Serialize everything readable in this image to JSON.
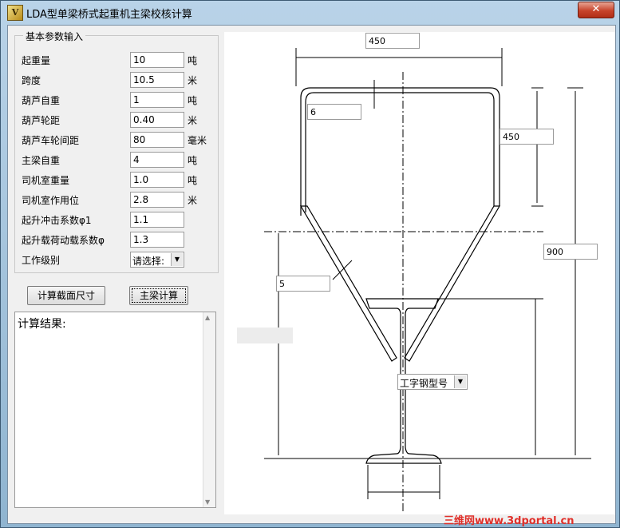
{
  "window": {
    "title": "LDA型单梁桥式起重机主梁校核计算",
    "close_glyph": "✕",
    "app_icon_glyph": "V"
  },
  "params": {
    "legend": "基本参数输入",
    "rows": [
      {
        "label": "起重量",
        "value": "10",
        "unit": "吨"
      },
      {
        "label": "跨度",
        "value": "10.5",
        "unit": "米"
      },
      {
        "label": "葫芦自重",
        "value": "1",
        "unit": "吨"
      },
      {
        "label": "葫芦轮距",
        "value": "0.40",
        "unit": "米"
      },
      {
        "label": "葫芦车轮间距",
        "value": "80",
        "unit": "毫米"
      },
      {
        "label": "主梁自重",
        "value": "4",
        "unit": "吨"
      },
      {
        "label": "司机室重量",
        "value": "1.0",
        "unit": "吨"
      },
      {
        "label": "司机室作用位",
        "value": "2.8",
        "unit": "米"
      },
      {
        "label": "起升冲击系数φ1",
        "value": "1.1",
        "unit": ""
      },
      {
        "label": "起升载荷动载系数φ",
        "value": "1.3",
        "unit": ""
      }
    ],
    "work_class": {
      "label": "工作级别",
      "selected": "请选择:"
    }
  },
  "buttons": {
    "calc_section": "计算截面尺寸",
    "calc_beam": "主梁计算"
  },
  "result": {
    "label": "计算结果:"
  },
  "drawing": {
    "top_width": "450",
    "top_plate_thickness": "6",
    "box_height": "450",
    "web_thickness": "5",
    "total_height": "900",
    "ibeam_select": "工字钢型号"
  },
  "watermark": "三维网www.3dportal.cn"
}
